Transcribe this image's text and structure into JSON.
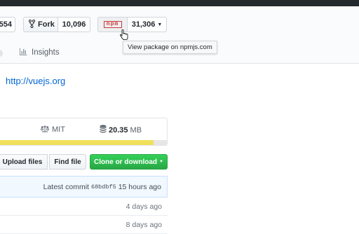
{
  "header": {
    "star_count": "554",
    "fork_label": "Fork",
    "fork_count": "10,096",
    "npm_logo_text": "npm",
    "npm_count": "31,306",
    "tooltip": "View package on npmjs.com",
    "insights_label": "Insights"
  },
  "repo": {
    "homepage": "http://vuejs.org"
  },
  "summary": {
    "license": "MIT",
    "size_value": "20.35",
    "size_unit": "MB",
    "lang_fill": 0.92
  },
  "file_nav": {
    "upload_label": "Upload files",
    "find_label": "Find file",
    "clone_label": "Clone or download"
  },
  "commit": {
    "prefix": "Latest commit",
    "sha": "68bdbf5",
    "time": "15 hours ago"
  },
  "files": [
    {
      "age": "4 days ago"
    },
    {
      "age": "8 days ago"
    }
  ]
}
